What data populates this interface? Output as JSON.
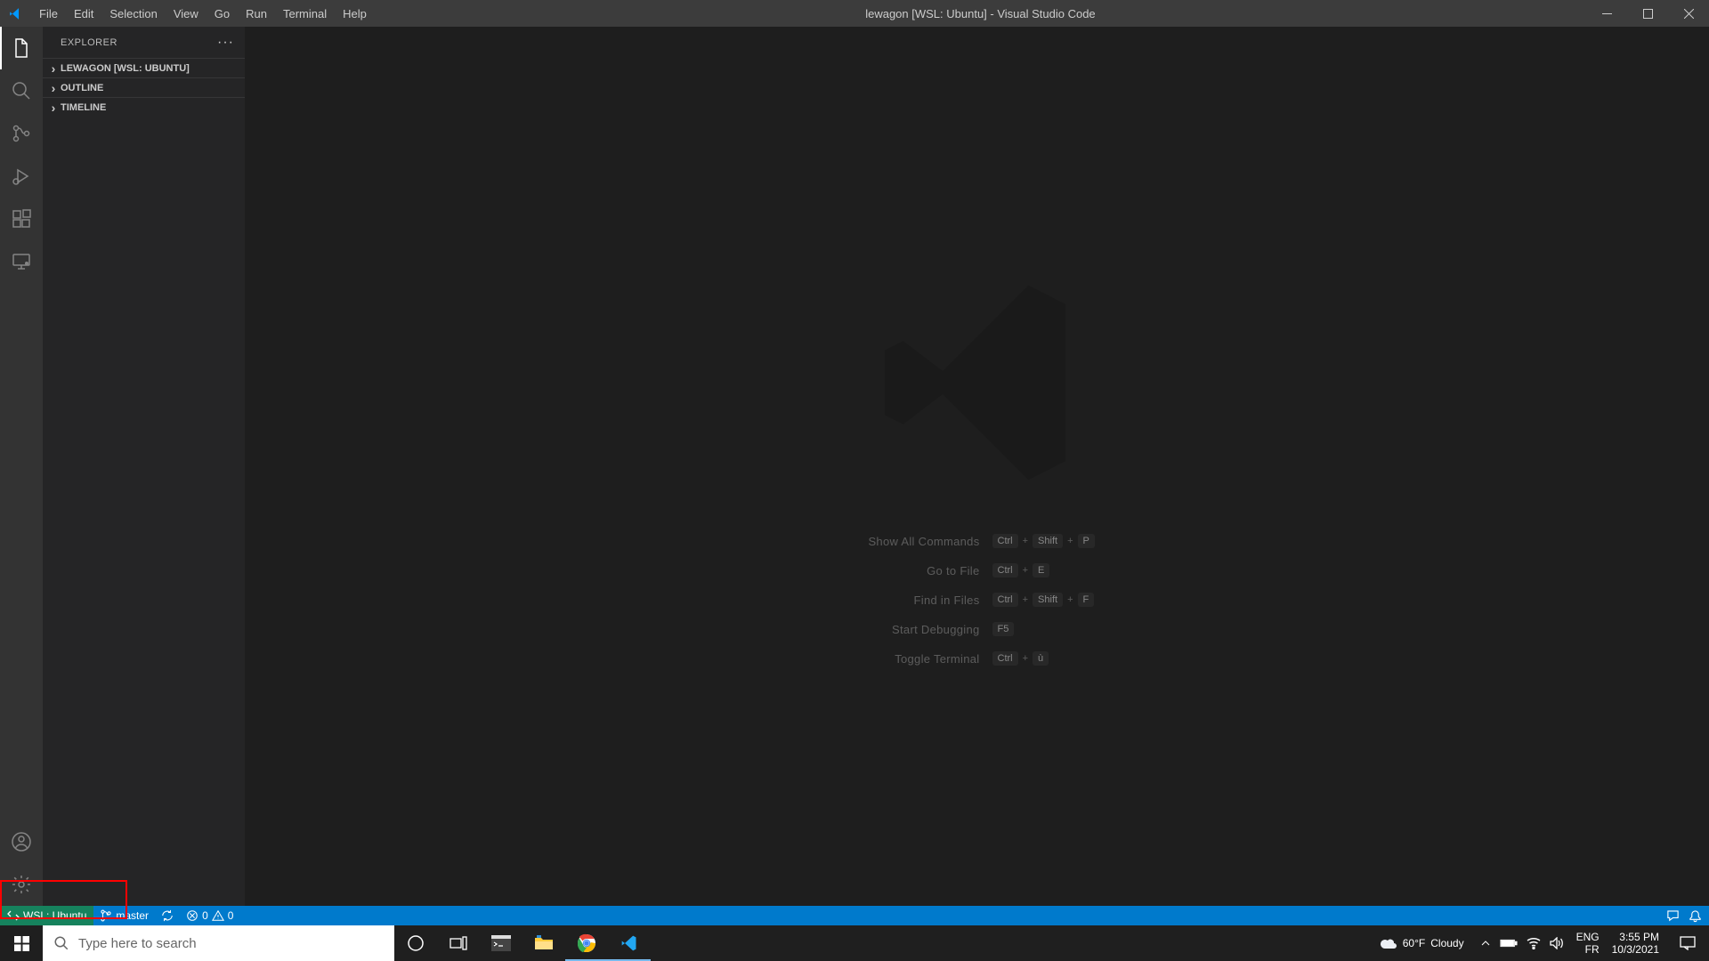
{
  "titlebar": {
    "menus": [
      "File",
      "Edit",
      "Selection",
      "View",
      "Go",
      "Run",
      "Terminal",
      "Help"
    ],
    "title": "lewagon [WSL: Ubuntu] - Visual Studio Code"
  },
  "sidebar": {
    "header": "EXPLORER",
    "sections": [
      "LEWAGON [WSL: UBUNTU]",
      "OUTLINE",
      "TIMELINE"
    ]
  },
  "shortcuts": [
    {
      "label": "Show All Commands",
      "keys": [
        "Ctrl",
        "Shift",
        "P"
      ]
    },
    {
      "label": "Go to File",
      "keys": [
        "Ctrl",
        "E"
      ]
    },
    {
      "label": "Find in Files",
      "keys": [
        "Ctrl",
        "Shift",
        "F"
      ]
    },
    {
      "label": "Start Debugging",
      "keys": [
        "F5"
      ]
    },
    {
      "label": "Toggle Terminal",
      "keys": [
        "Ctrl",
        "ù"
      ]
    }
  ],
  "statusbar": {
    "remote": "WSL: Ubuntu",
    "branch": "master",
    "errors": "0",
    "warnings": "0"
  },
  "taskbar": {
    "search_placeholder": "Type here to search",
    "weather_temp": "60°F",
    "weather_cond": "Cloudy",
    "lang1": "ENG",
    "lang2": "FR",
    "time": "3:55 PM",
    "date": "10/3/2021"
  }
}
